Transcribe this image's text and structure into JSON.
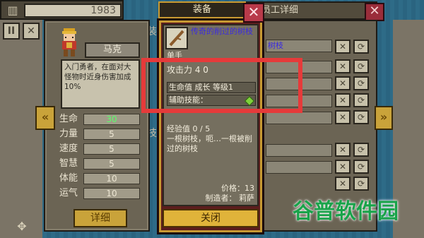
{
  "top": {
    "year": "1983"
  },
  "left_panel": {
    "side_label_top": "装",
    "side_label_mid": "技",
    "character": {
      "name": "马克",
      "description": "入门勇者，在面对大怪物时近身伤害加成10%",
      "stats": [
        {
          "label": "生命",
          "value": "30"
        },
        {
          "label": "力量",
          "value": "5"
        },
        {
          "label": "速度",
          "value": "5"
        },
        {
          "label": "智慧",
          "value": "5"
        },
        {
          "label": "体能",
          "value": "10"
        },
        {
          "label": "运气",
          "value": "10"
        }
      ],
      "detail_button": "详细"
    }
  },
  "background_panel": {
    "title": "员工详细",
    "item_label": "树枝",
    "close_icon": "close-icon"
  },
  "dialog": {
    "title": "装备",
    "item": {
      "name": "传奇的削过的树枝",
      "hand": "单手",
      "attack": "攻击力 4 0",
      "growth_row": "生命值 成长 等级1",
      "aux_skill": "辅助技能：",
      "exp": "经验值 0 / 5",
      "flavor": "一根树枝，呃…一根被削过的树枝",
      "price": "价格：13",
      "maker": "制造者： 莉萨"
    },
    "close_button": "关闭"
  },
  "watermark": "谷普软件园",
  "colors": {
    "highlight": "#e63a3a",
    "gold": "#c9a33a",
    "item_name": "#3b2be0",
    "stat_green": "#5aff6a"
  }
}
